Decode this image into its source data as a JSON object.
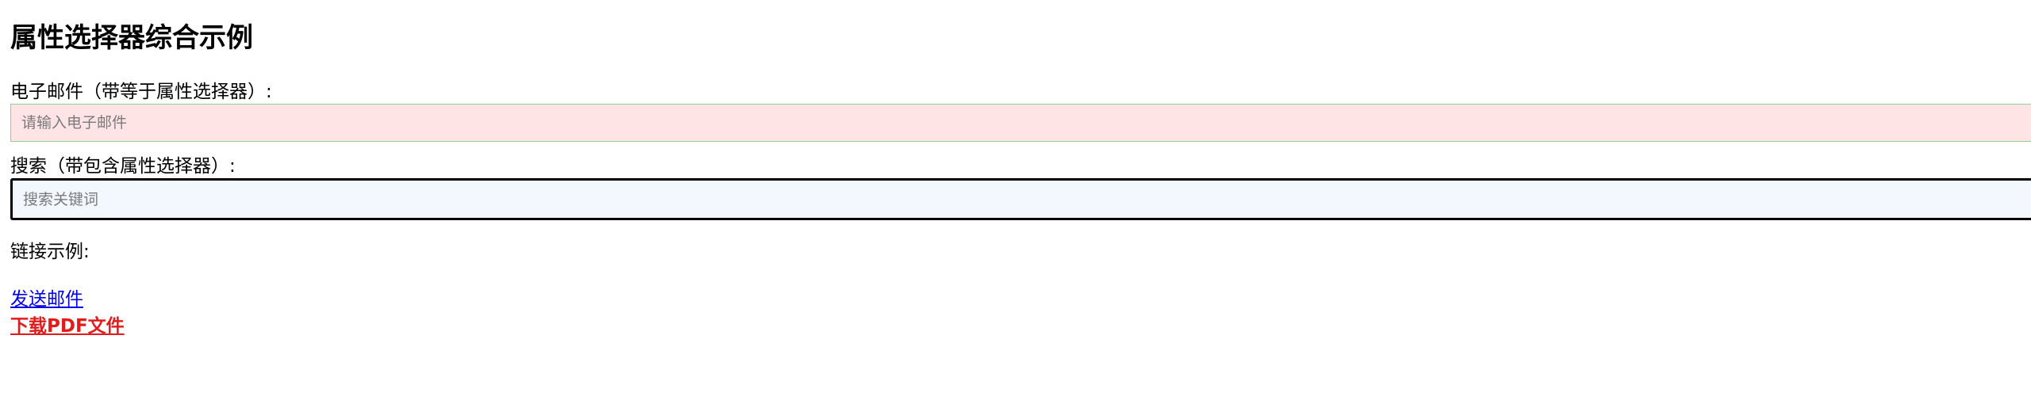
{
  "page": {
    "title": "属性选择器综合示例"
  },
  "form": {
    "email": {
      "label": "电子邮件（带等于属性选择器）:",
      "placeholder": "请输入电子邮件",
      "value": ""
    },
    "search": {
      "label": "搜索（带包含属性选择器）:",
      "placeholder": "搜索关键词",
      "value": ""
    }
  },
  "links": {
    "heading": "链接示例:",
    "items": [
      {
        "label": "发送邮件"
      },
      {
        "label": "下载PDF文件"
      }
    ]
  },
  "colors": {
    "email_bg": "#ffe4e6",
    "email_border": "#8fd18f",
    "search_bg": "#f3f8ff",
    "search_border": "#000000",
    "mail_link": "#0000ee",
    "pdf_link": "#e41b1b"
  }
}
